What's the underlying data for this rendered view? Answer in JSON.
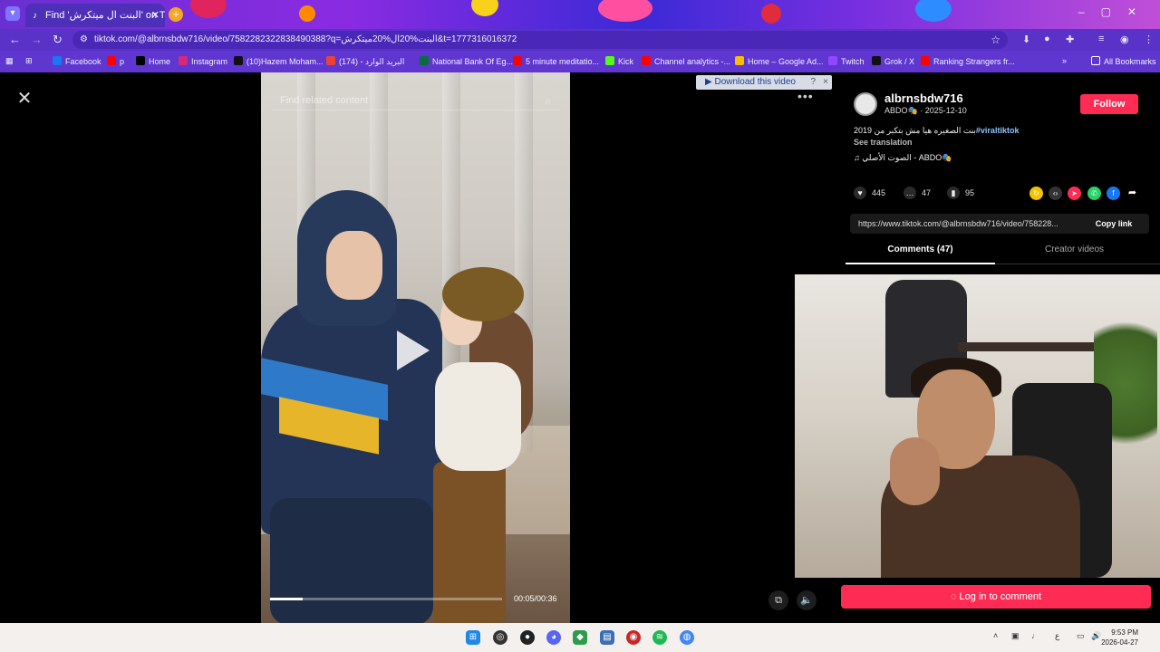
{
  "browser": {
    "tab_title": "Find 'البنت ال ميتكرش' on TikTok",
    "url": "tiktok.com/@albrnsbdw716/video/7582282322838490388?q=البنت%20ال%20ميتكرش&t=1777316016372"
  },
  "bookmarks": [
    {
      "label": "Facebook",
      "color": "#1877f2"
    },
    {
      "label": "p",
      "color": "#ff0000"
    },
    {
      "label": "Home",
      "color": "#000000"
    },
    {
      "label": "Instagram",
      "color": "#d62976"
    },
    {
      "label": "(10)Hazem Moham...",
      "color": "#111111"
    },
    {
      "label": "(174) - البريد الوارد",
      "color": "#ea4335"
    },
    {
      "label": "National Bank Of Eg...",
      "color": "#0a6b3b"
    },
    {
      "label": "5 minute meditatio...",
      "color": "#ff0000"
    },
    {
      "label": "Kick",
      "color": "#53fc18"
    },
    {
      "label": "Channel analytics -...",
      "color": "#ff0000"
    },
    {
      "label": "Home – Google Ad...",
      "color": "#fbbc04"
    },
    {
      "label": "Twitch",
      "color": "#9146ff"
    },
    {
      "label": "Grok / X",
      "color": "#111111"
    },
    {
      "label": "Ranking Strangers fr...",
      "color": "#ff0000"
    }
  ],
  "all_bookmarks": "All Bookmarks",
  "video": {
    "search_placeholder": "Find related content",
    "time": "00:05/00:36",
    "progress": 0.14
  },
  "download_bar": {
    "label": "Download this video",
    "help": "?",
    "close": "×"
  },
  "author": {
    "username": "albrnsbdw716",
    "sub": "ABDO🎭 · 2025-12-10",
    "follow": "Follow"
  },
  "caption": {
    "text": "بنت الصغيره هيا مش بتكبر من 2019",
    "hashtag": "#viraltiktok",
    "see_translation": "See translation",
    "music": "الصوت الأصلي - ABDO🎭"
  },
  "stats": {
    "likes": "445",
    "comments": "47",
    "saves": "95"
  },
  "share_colors": [
    "#f5c400",
    "#333333",
    "#fe2c55",
    "#25d366",
    "#1877f2"
  ],
  "link": {
    "url": "https://www.tiktok.com/@albrnsbdw716/video/758228...",
    "copy": "Copy link"
  },
  "tabs": {
    "comments": "Comments (47)",
    "creator": "Creator videos"
  },
  "login": "Log in to comment",
  "taskbar": {
    "time": "9:53 PM",
    "date": "2026-04-27"
  }
}
